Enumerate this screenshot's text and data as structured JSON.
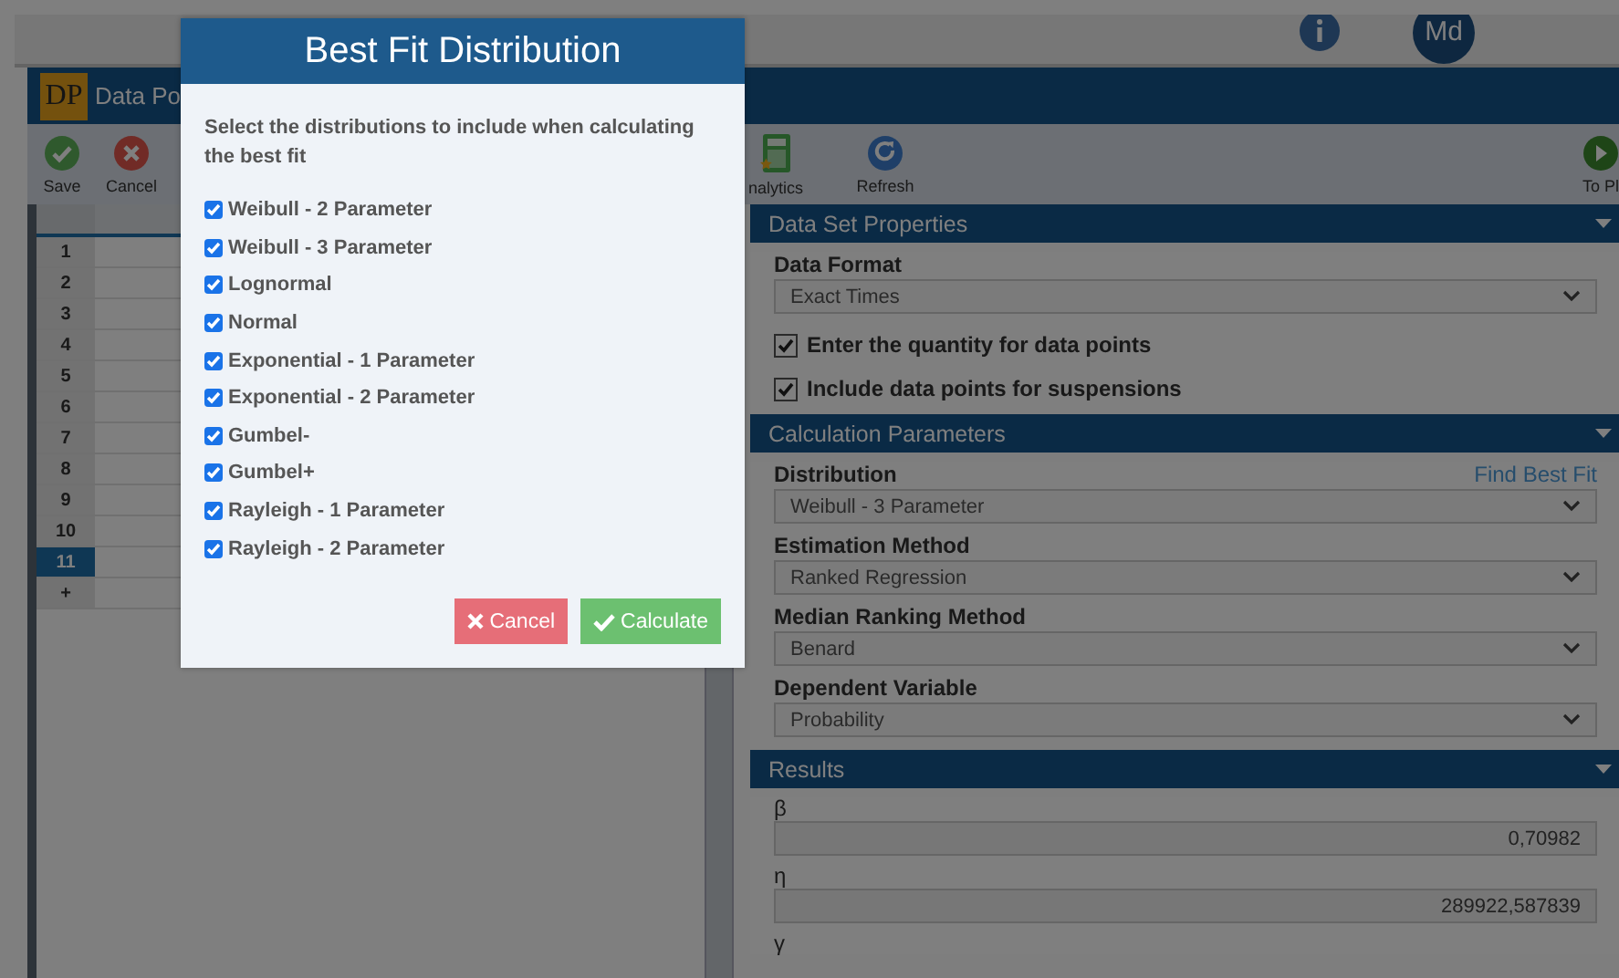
{
  "top_bar": {
    "avatar": "Md"
  },
  "window": {
    "logo": "DP",
    "title": "Data Po"
  },
  "toolbar": {
    "left": [
      {
        "kind": "save",
        "label": "Save"
      },
      {
        "kind": "cancel",
        "label": "Cancel"
      }
    ],
    "middle": [
      {
        "kind": "analytics",
        "label": "nalytics"
      },
      {
        "kind": "refresh",
        "label": "Refresh"
      }
    ],
    "right": [
      {
        "kind": "plot",
        "label": "To Pl"
      }
    ]
  },
  "grid": {
    "rows": [
      {
        "label": "1",
        "selected": false
      },
      {
        "label": "2",
        "selected": false
      },
      {
        "label": "3",
        "selected": false
      },
      {
        "label": "4",
        "selected": false
      },
      {
        "label": "5",
        "selected": false
      },
      {
        "label": "6",
        "selected": false
      },
      {
        "label": "7",
        "selected": false
      },
      {
        "label": "8",
        "selected": false
      },
      {
        "label": "9",
        "selected": false
      },
      {
        "label": "10",
        "selected": false
      },
      {
        "label": "11",
        "selected": true
      },
      {
        "label": "+",
        "selected": false
      }
    ]
  },
  "panels": [
    {
      "title": "Data Set Properties",
      "fields": [
        {
          "kind": "select",
          "label": "Data Format",
          "value": "Exact Times"
        },
        {
          "kind": "checkbox",
          "label": "Enter the quantity for data points",
          "checked": true
        },
        {
          "kind": "checkbox",
          "label": "Include data points for suspensions",
          "checked": true
        }
      ]
    },
    {
      "title": "Calculation Parameters",
      "fields": [
        {
          "kind": "select",
          "label": "Distribution",
          "link": "Find Best Fit",
          "value": "Weibull - 3 Parameter"
        },
        {
          "kind": "select",
          "label": "Estimation Method",
          "value": "Ranked Regression"
        },
        {
          "kind": "select",
          "label": "Median Ranking Method",
          "value": "Benard"
        },
        {
          "kind": "select",
          "label": "Dependent Variable",
          "value": "Probability"
        }
      ]
    },
    {
      "title": "Results",
      "fields": [
        {
          "kind": "number",
          "label": "β",
          "value": "0,70982"
        },
        {
          "kind": "number",
          "label": "η",
          "value": "289922,587839"
        },
        {
          "kind": "label",
          "label": "γ"
        }
      ]
    }
  ],
  "dialog": {
    "title": "Best Fit Distribution",
    "instructions": "Select the distributions to include when calculating the best fit",
    "options": [
      {
        "label": "Weibull - 2 Parameter",
        "checked": true
      },
      {
        "label": "Weibull - 3 Parameter",
        "checked": true
      },
      {
        "label": "Lognormal",
        "checked": true
      },
      {
        "label": "Normal",
        "checked": true
      },
      {
        "label": "Exponential - 1 Parameter",
        "checked": true
      },
      {
        "label": "Exponential - 2 Parameter",
        "checked": true
      },
      {
        "label": "Gumbel-",
        "checked": true
      },
      {
        "label": "Gumbel+",
        "checked": true
      },
      {
        "label": "Rayleigh - 1 Parameter",
        "checked": true
      },
      {
        "label": "Rayleigh - 2 Parameter",
        "checked": true
      }
    ],
    "buttons": [
      {
        "kind": "cancel",
        "label": "Cancel"
      },
      {
        "kind": "calculate",
        "label": "Calculate"
      }
    ]
  }
}
